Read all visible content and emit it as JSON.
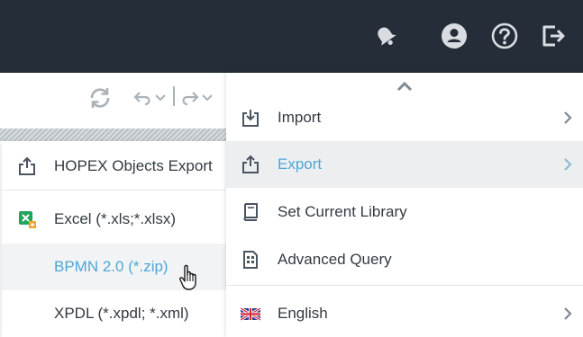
{
  "header": {
    "icons": [
      "bell-icon",
      "user-account-icon",
      "help-icon",
      "logout-icon"
    ]
  },
  "toolbar": {
    "icons": [
      "refresh-icon",
      "undo-icon",
      "undo-dropdown-icon",
      "redo-icon",
      "redo-dropdown-icon"
    ]
  },
  "submenu": {
    "items": [
      {
        "label": "HOPEX Objects Export",
        "icon": "export-icon"
      },
      {
        "label": "Excel (*.xls;*.xlsx)",
        "icon": "excel-icon"
      },
      {
        "label": "BPMN 2.0 (*.zip)",
        "icon": ""
      },
      {
        "label": "XPDL (*.xpdl; *.xml)",
        "icon": ""
      }
    ]
  },
  "menu": {
    "items": [
      {
        "label": "Import",
        "icon": "import-icon",
        "has_submenu": true
      },
      {
        "label": "Export",
        "icon": "export-icon",
        "has_submenu": true
      },
      {
        "label": "Set Current Library",
        "icon": "book-icon",
        "has_submenu": false
      },
      {
        "label": "Advanced Query",
        "icon": "query-document-icon",
        "has_submenu": false
      },
      {
        "label": "English",
        "icon": "uk-flag-icon",
        "has_submenu": true
      }
    ]
  },
  "colors": {
    "header_bg": "#252e38",
    "accent": "#4ea7d8",
    "highlight_bg": "#eceef0",
    "text": "#333a42"
  }
}
